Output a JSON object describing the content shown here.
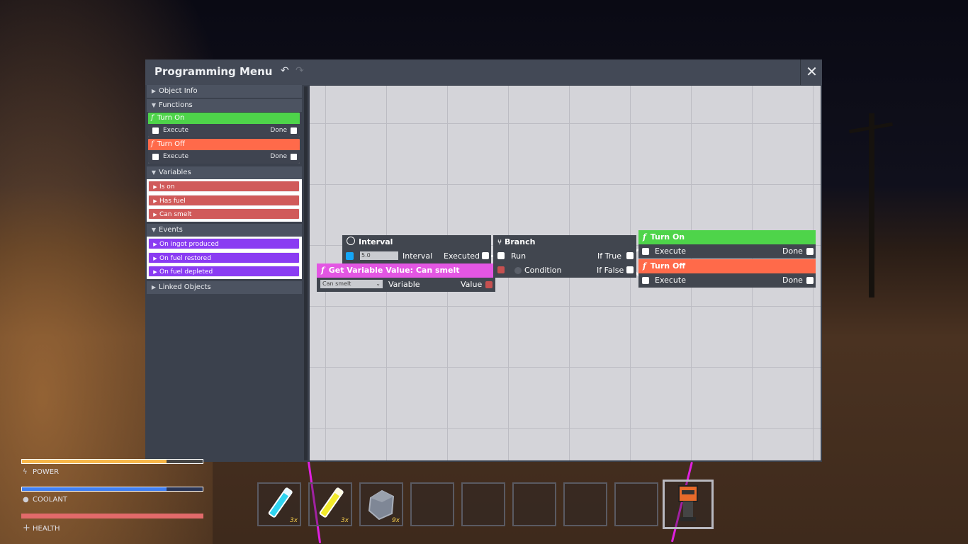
{
  "window": {
    "title": "Programming Menu",
    "undo_icon": "↶",
    "redo_icon": "↷",
    "close_icon": "✕"
  },
  "sidebar": {
    "object_info": "Object Info",
    "functions": "Functions",
    "function_cards": [
      {
        "name": "Turn On",
        "color": "#4ed44a",
        "execute": "Execute",
        "done": "Done"
      },
      {
        "name": "Turn Off",
        "color": "#ff6a4a",
        "execute": "Execute",
        "done": "Done"
      }
    ],
    "variables": "Variables",
    "variable_items": [
      "Is on",
      "Has fuel",
      "Can smelt"
    ],
    "events": "Events",
    "event_items": [
      "On ingot produced",
      "On fuel restored",
      "On fuel depleted"
    ],
    "linked_objects": "Linked Objects"
  },
  "nodes": {
    "interval": {
      "title": "Interval",
      "value": "5.0",
      "param_label": "Interval",
      "output_label": "Executed"
    },
    "get_variable": {
      "title": "Get Variable Value: Can smelt",
      "selected": "Can smelt",
      "param_label": "Variable",
      "output_label": "Value"
    },
    "branch": {
      "title": "Branch",
      "run": "Run",
      "condition": "Condition",
      "if_true": "If True",
      "if_false": "If False"
    },
    "turn_on": {
      "title": "Turn On",
      "execute": "Execute",
      "done": "Done"
    },
    "turn_off": {
      "title": "Turn Off",
      "execute": "Execute",
      "done": "Done"
    }
  },
  "hud": {
    "power": {
      "label": "POWER",
      "level": 0.8
    },
    "coolant": {
      "label": "COOLANT",
      "level": 0.8
    },
    "health": {
      "label": "HEALTH",
      "level": 1.0
    }
  },
  "hotbar": {
    "slots": [
      {
        "icon": "cyan-tube-icon",
        "count": "3x"
      },
      {
        "icon": "yellow-tube-icon",
        "count": "3x"
      },
      {
        "icon": "rock-icon",
        "count": "9x"
      },
      {
        "icon": "",
        "count": ""
      },
      {
        "icon": "",
        "count": ""
      },
      {
        "icon": "",
        "count": ""
      },
      {
        "icon": "",
        "count": ""
      },
      {
        "icon": "",
        "count": ""
      },
      {
        "icon": "robot-icon",
        "count": ""
      }
    ]
  },
  "colors": {
    "function_on": "#4ed44a",
    "function_off": "#ff6a4a",
    "variable": "#d05a5a",
    "event": "#8a3cf2",
    "get_variable": "#e356e3",
    "power": "#f7b74a",
    "coolant": "#3f7ff2",
    "health": "#e26a6a",
    "interval_port": "#14a6f7"
  }
}
